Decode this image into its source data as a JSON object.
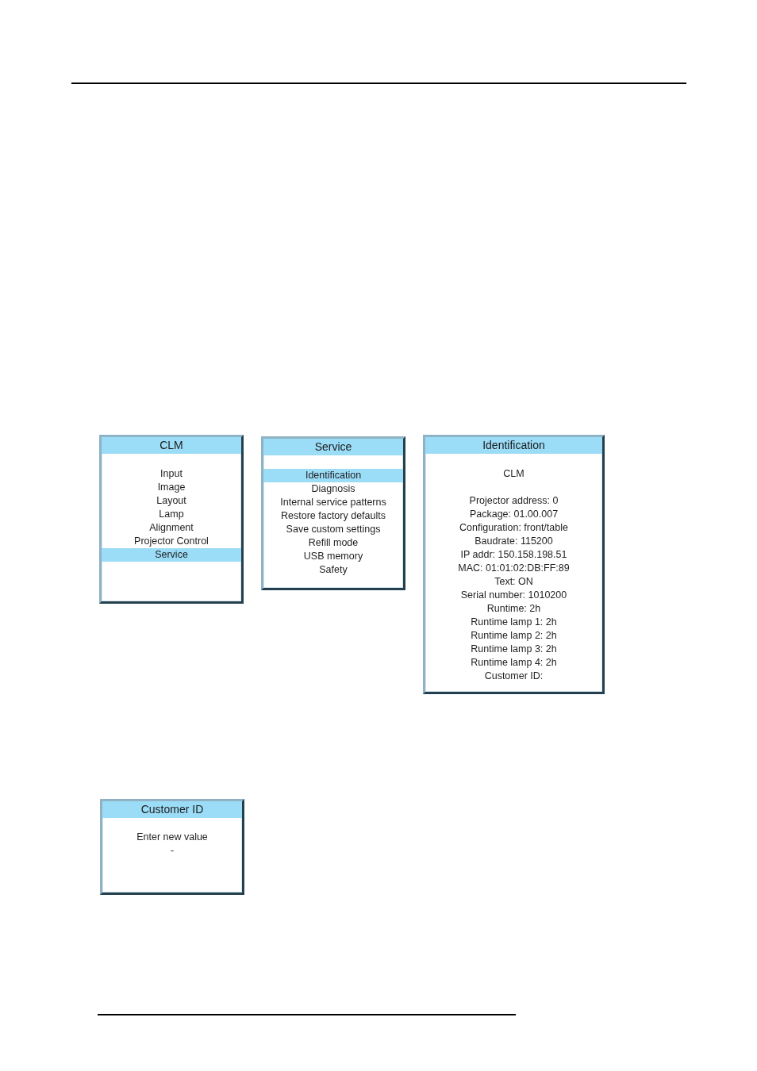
{
  "menus": [
    {
      "title": "CLM",
      "items": [
        {
          "label": "Input",
          "selected": false
        },
        {
          "label": "Image",
          "selected": false
        },
        {
          "label": "Layout",
          "selected": false
        },
        {
          "label": "Lamp",
          "selected": false
        },
        {
          "label": "Alignment",
          "selected": false
        },
        {
          "label": "Projector Control",
          "selected": false
        },
        {
          "label": "Service",
          "selected": true
        }
      ]
    },
    {
      "title": "Service",
      "items": [
        {
          "label": "Identification",
          "selected": true
        },
        {
          "label": "Diagnosis",
          "selected": false
        },
        {
          "label": "Internal service patterns",
          "selected": false
        },
        {
          "label": "Restore factory defaults",
          "selected": false
        },
        {
          "label": "Save custom settings",
          "selected": false
        },
        {
          "label": "Refill mode",
          "selected": false
        },
        {
          "label": "USB memory",
          "selected": false
        },
        {
          "label": "Safety",
          "selected": false
        }
      ]
    }
  ],
  "identification": {
    "title": "Identification",
    "device_name": "CLM",
    "fields": [
      "Projector address: 0",
      "Package: 01.00.007",
      "Configuration: front/table",
      "Baudrate: 115200",
      "IP addr: 150.158.198.51",
      "MAC: 01:01:02:DB:FF:89",
      "Text: ON",
      "Serial number: 1010200",
      "Runtime: 2h",
      "Runtime lamp 1: 2h",
      "Runtime lamp 2: 2h",
      "Runtime lamp 3: 2h",
      "Runtime lamp 4: 2h",
      "Customer ID:"
    ]
  },
  "customer_id_dialog": {
    "title": "Customer ID",
    "prompt": "Enter new value",
    "value": "-"
  }
}
